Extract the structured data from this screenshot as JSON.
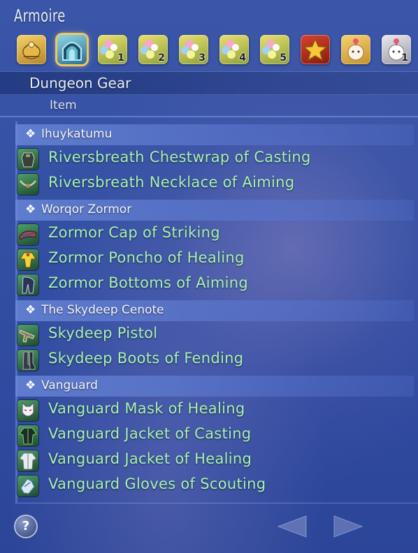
{
  "window": {
    "title": "Armoire"
  },
  "tabs": [
    {
      "name": "gear-bag-icon",
      "badge": ""
    },
    {
      "name": "portal-icon",
      "badge": "",
      "selected": true
    },
    {
      "name": "flower-1-icon",
      "badge": "1"
    },
    {
      "name": "flower-2-icon",
      "badge": "2"
    },
    {
      "name": "flower-3-icon",
      "badge": "3"
    },
    {
      "name": "flower-4-icon",
      "badge": "4"
    },
    {
      "name": "flower-5-icon",
      "badge": "5"
    },
    {
      "name": "star-icon",
      "badge": ""
    },
    {
      "name": "moogle-icon",
      "badge": ""
    },
    {
      "name": "moogle-1-icon",
      "badge": "1"
    }
  ],
  "section": {
    "title": "Dungeon Gear"
  },
  "column": {
    "header": "Item"
  },
  "groups": [
    {
      "name": "Ihuykatumu",
      "items": [
        {
          "label": "Riversbreath Chestwrap of Casting",
          "icon": "chestwrap-icon"
        },
        {
          "label": "Riversbreath Necklace of Aiming",
          "icon": "necklace-icon"
        }
      ]
    },
    {
      "name": "Worqor Zormor",
      "items": [
        {
          "label": "Zormor Cap of Striking",
          "icon": "cap-icon"
        },
        {
          "label": "Zormor Poncho of Healing",
          "icon": "poncho-icon"
        },
        {
          "label": "Zormor Bottoms of Aiming",
          "icon": "bottoms-icon"
        }
      ]
    },
    {
      "name": "The Skydeep Cenote",
      "items": [
        {
          "label": "Skydeep Pistol",
          "icon": "pistol-icon"
        },
        {
          "label": "Skydeep Boots of Fending",
          "icon": "boots-icon"
        }
      ]
    },
    {
      "name": "Vanguard",
      "items": [
        {
          "label": "Vanguard Mask of Healing",
          "icon": "mask-icon"
        },
        {
          "label": "Vanguard Jacket of Casting",
          "icon": "jacket-icon"
        },
        {
          "label": "Vanguard Jacket of Healing",
          "icon": "jacket-icon"
        },
        {
          "label": "Vanguard Gloves of Scouting",
          "icon": "gloves-icon"
        }
      ]
    }
  ],
  "footer": {
    "help_label": "?"
  },
  "colors": {
    "item_text": "#a7f3b4",
    "accent": "#f0c860"
  }
}
